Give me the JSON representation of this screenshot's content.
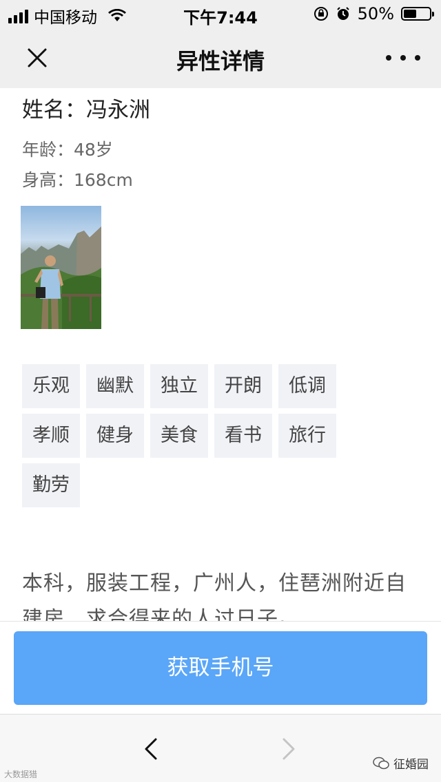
{
  "status_bar": {
    "carrier": "中国移动",
    "time": "下午7:44",
    "battery_text": "50%",
    "battery_level": 0.5,
    "icons": [
      "signal-icon",
      "wifi-icon",
      "orientation-lock-icon",
      "alarm-icon",
      "battery-icon"
    ]
  },
  "nav": {
    "title": "异性详情",
    "close_icon": "close-icon",
    "more_icon": "more-icon"
  },
  "profile": {
    "name": "姓名：冯永洲",
    "age": "年龄：48岁",
    "height": "身高：168cm",
    "photo_icon": "profile-photo"
  },
  "tags": [
    "乐观",
    "幽默",
    "独立",
    "开朗",
    "低调",
    "孝顺",
    "健身",
    "美食",
    "看书",
    "旅行",
    "勤劳"
  ],
  "description": "本科，服装工程，广州人，住琶洲附近自建房，求合得来的人过日子。",
  "action": {
    "label": "获取手机号",
    "color": "#5aa6f8"
  },
  "toolbar": {
    "back_icon": "back-arrow-icon",
    "forward_icon": "forward-arrow-icon",
    "watermark_left": "大数据猎",
    "watermark_right": "征婚园"
  }
}
